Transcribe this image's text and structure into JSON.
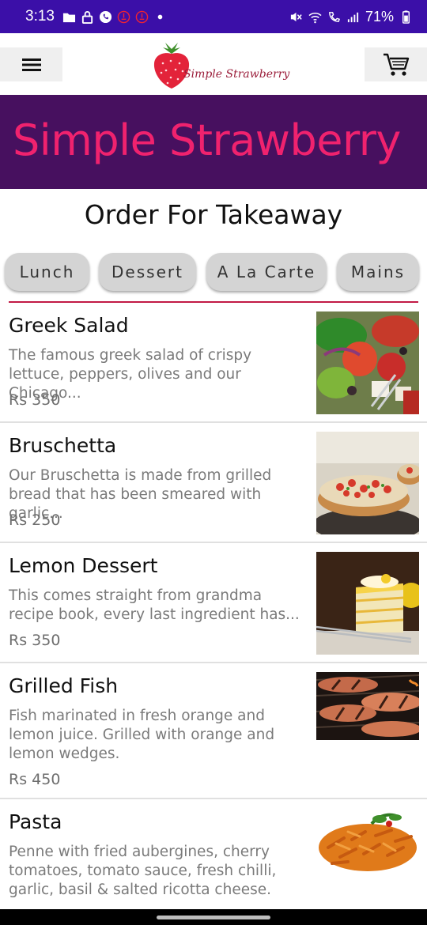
{
  "status_bar": {
    "time": "3:13",
    "battery": "71%",
    "left_icons": [
      "folder-icon",
      "lock-icon",
      "whatsapp-icon",
      "app-notification-icon",
      "app-notification-icon",
      "dot-icon"
    ],
    "right_icons": [
      "mute-icon",
      "wifi-icon",
      "wifi-calling-icon",
      "signal-icon",
      "battery-icon"
    ]
  },
  "app_bar": {
    "menu_icon": "hamburger-menu-icon",
    "logo_text": "Simple Strawberry",
    "cart_icon": "shopping-cart-icon"
  },
  "hero": {
    "title": "Simple Strawberry",
    "background": "#47105f",
    "title_color": "#f0226e"
  },
  "order_heading": "Order For Takeaway",
  "categories": [
    "Lunch",
    "Dessert",
    "A La Carte",
    "Mains"
  ],
  "accent_color": "#c21a45",
  "menu_items": [
    {
      "name": "Greek Salad",
      "description": "The famous greek salad of crispy lettuce, peppers, olives and our Chicago...",
      "price": "Rs 350",
      "image": "greek-salad-photo"
    },
    {
      "name": "Bruschetta",
      "description": "Our Bruschetta is made from grilled bread that has been smeared with garlic...",
      "price": "Rs 250",
      "image": "bruschetta-photo"
    },
    {
      "name": "Lemon Dessert",
      "description": "This comes straight from grandma recipe book, every last ingredient has...",
      "price": "Rs 350",
      "image": "lemon-dessert-photo"
    },
    {
      "name": "Grilled Fish",
      "description": "Fish marinated in fresh orange and lemon juice. Grilled with orange and lemon wedges.",
      "price": "Rs 450",
      "image": "grilled-fish-photo"
    },
    {
      "name": "Pasta",
      "description": "Penne with fried aubergines, cherry tomatoes, tomato sauce, fresh chilli, garlic, basil & salted ricotta cheese.",
      "price": "",
      "image": "pasta-photo"
    }
  ]
}
